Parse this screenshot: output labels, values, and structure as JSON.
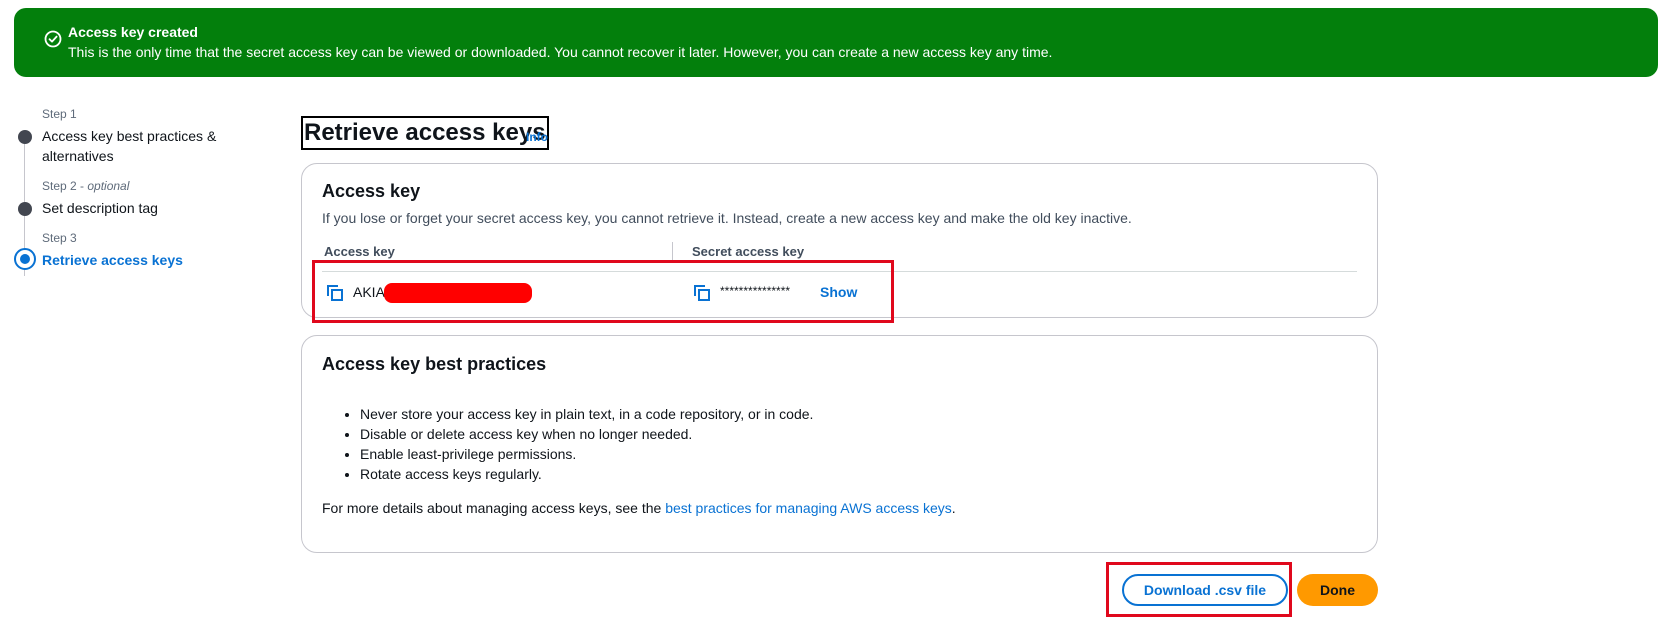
{
  "flash": {
    "title": "Access key created",
    "message": "This is the only time that the secret access key can be viewed or downloaded. You cannot recover it later. However, you can create a new access key any time."
  },
  "steps": [
    {
      "label": "Step 1",
      "title": "Access key best practices & alternatives"
    },
    {
      "label": "Step 2 - ",
      "optional": "optional",
      "title": "Set description tag"
    },
    {
      "label": "Step 3",
      "title": "Retrieve access keys"
    }
  ],
  "page": {
    "title": "Retrieve access keys",
    "info": "Info"
  },
  "access_key_card": {
    "heading": "Access key",
    "description": "If you lose or forget your secret access key, you cannot retrieve it. Instead, create a new access key and make the old key inactive.",
    "col_access_key": "Access key",
    "col_secret_key": "Secret access key",
    "access_key_value": "AKIA",
    "secret_key_value": "***************",
    "show_label": "Show"
  },
  "best_practices": {
    "heading": "Access key best practices",
    "items": [
      "Never store your access key in plain text, in a code repository, or in code.",
      "Disable or delete access key when no longer needed.",
      "Enable least-privilege permissions.",
      "Rotate access keys regularly."
    ],
    "more_prefix": "For more details about managing access keys, see the ",
    "more_link": "best practices for managing AWS access keys",
    "more_suffix": "."
  },
  "actions": {
    "download": "Download .csv file",
    "done": "Done"
  },
  "colors": {
    "success": "#037f0c",
    "link": "#0972d3",
    "primary": "#ff9900",
    "highlight": "#e0081c"
  }
}
